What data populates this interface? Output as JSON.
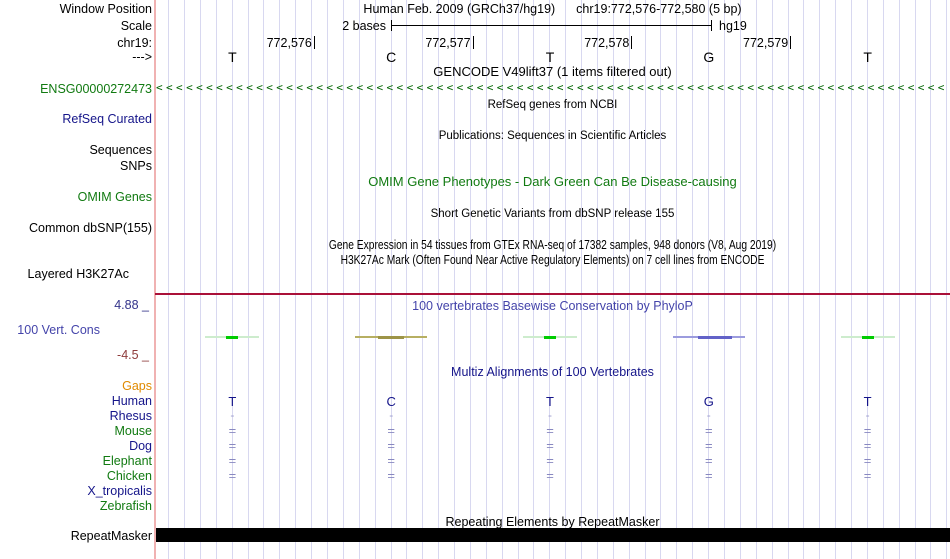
{
  "colors": {
    "gene_green": "#117a11",
    "chevron_green": "#006400",
    "navy": "#15158a",
    "phylop_blue": "#4444aa",
    "gaps_orange": "#e08a00",
    "maroon_line": "#aa1038",
    "axis_max_color": "#33338a",
    "axis_min_color": "#8e3b3b",
    "grid_line": "#d8d8f0",
    "divider_pink": "#f0b2b2",
    "align_mark_blue": "#8888c0",
    "repeat_bar_black": "#000000",
    "cons_green": "#00cc00",
    "cons_pale_green": "#cdeccd",
    "cons_olive": "#b7af62",
    "cons_blue": "#6262c8"
  },
  "header": {
    "window_position_label": "Window Position",
    "assembly": "Human Feb. 2009 (GRCh37/hg19)",
    "position": "chr19:772,576-772,580 (5 bp)",
    "scale_label": "Scale",
    "scale_value": "2 bases",
    "assembly_short": "hg19",
    "chrom_label": "chr19:",
    "strand_label": "--->",
    "ruler_ticks": [
      "772,576",
      "772,577",
      "772,578",
      "772,579"
    ],
    "bases": [
      "T",
      "C",
      "T",
      "G",
      "T"
    ]
  },
  "gencode": {
    "title": "GENCODE V49lift37 (1 items filtered out)",
    "gene_id": "ENSG00000272473",
    "strand_char": "<",
    "strand_count": 79
  },
  "refseq": {
    "label": "RefSeq Curated",
    "title": "RefSeq genes from NCBI"
  },
  "publications": {
    "label_line1": "Sequences",
    "label_line2": "SNPs",
    "title": "Publications: Sequences in Scientific Articles"
  },
  "omim": {
    "label": "OMIM Genes",
    "title": "OMIM Gene Phenotypes - Dark Green Can Be Disease-causing"
  },
  "dbsnp": {
    "label": "Common dbSNP(155)",
    "title": "Short Genetic Variants from dbSNP release 155"
  },
  "gtex": {
    "title": "Gene Expression in 54 tissues from GTEx RNA-seq of 17382 samples, 948 donors (V8, Aug 2019)"
  },
  "h3k27ac": {
    "label": "Layered H3K27Ac",
    "title": "H3K27Ac Mark (Often Found Near Active Regulatory Elements) on 7 cell lines from ENCODE"
  },
  "phylop": {
    "label": "100 Vert. Cons",
    "title": "100 vertebrates Basewise Conservation by PhyloP",
    "axis_max": "4.88 _",
    "axis_min": "-4.5 _",
    "marks": [
      {
        "column": 1,
        "base": "T",
        "kind": "green"
      },
      {
        "column": 2,
        "base": "C",
        "kind": "olive"
      },
      {
        "column": 3,
        "base": "T",
        "kind": "green"
      },
      {
        "column": 4,
        "base": "G",
        "kind": "blue"
      },
      {
        "column": 5,
        "base": "T",
        "kind": "green"
      }
    ]
  },
  "multiz": {
    "title": "Multiz Alignments of 100 Vertebrates",
    "species": [
      {
        "name": "Gaps",
        "color": "#e08a00",
        "marks": "none"
      },
      {
        "name": "Human",
        "color": "#15158a",
        "marks": "bases"
      },
      {
        "name": "Rhesus",
        "color": "#15158a",
        "marks": "dash"
      },
      {
        "name": "Mouse",
        "color": "#117a11",
        "marks": "equals"
      },
      {
        "name": "Dog",
        "color": "#15158a",
        "marks": "equals"
      },
      {
        "name": "Elephant",
        "color": "#117a11",
        "marks": "equals"
      },
      {
        "name": "Chicken",
        "color": "#117a11",
        "marks": "equals"
      },
      {
        "name": "X_tropicalis",
        "color": "#15158a",
        "marks": "none"
      },
      {
        "name": "Zebrafish",
        "color": "#117a11",
        "marks": "none"
      }
    ]
  },
  "repeatmasker": {
    "label": "RepeatMasker",
    "title": "Repeating Elements by RepeatMasker"
  }
}
